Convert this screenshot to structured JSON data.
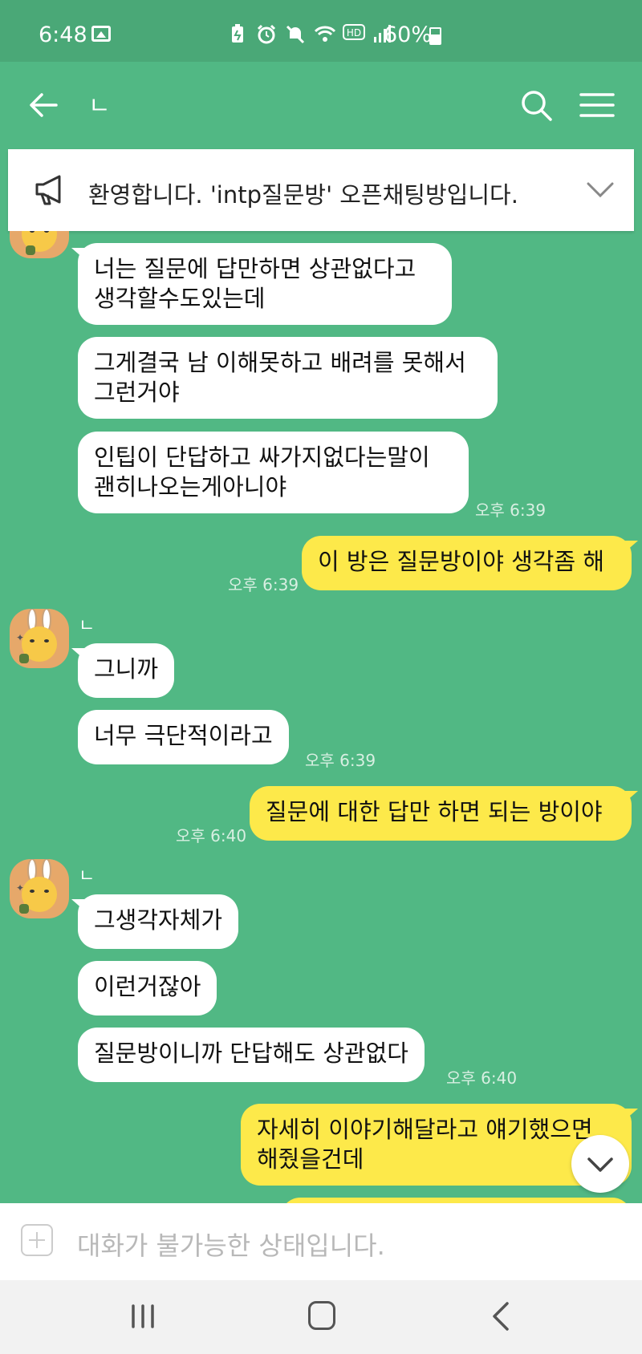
{
  "status_bar": {
    "time": "6:48",
    "battery": "60%"
  },
  "header": {
    "title": "ㄴ"
  },
  "notice": {
    "text": "환영합니다. 'intp질문방' 오픈채팅방입니다."
  },
  "messages": {
    "g1": {
      "b1": "너는 질문에 답만하면 상관없다고\n생각할수도있는데",
      "b2": "그게결국 남 이해못하고 배려를 못해서\n그런거야",
      "b3": "인팁이 단답하고 싸가지없다는말이\n괜히나오는게아니야",
      "time": "오후 6:39"
    },
    "o1": {
      "text": "이 방은 질문방이야 생각좀 해",
      "time": "오후 6:39"
    },
    "g2": {
      "sender": "ㄴ",
      "b1": "그니까",
      "b2": "너무 극단적이라고",
      "time": "오후 6:39"
    },
    "o2": {
      "text": "질문에 대한 답만 하면 되는 방이야",
      "time": "오후 6:40"
    },
    "g3": {
      "sender": "ㄴ",
      "b1": "그생각자체가",
      "b2": "이런거잖아",
      "b3": "질문방이니까 단답해도 상관없다",
      "time": "오후 6:40"
    },
    "o3": {
      "text": "자세히 이야기해달라고 얘기했으면\n해줬을건데"
    }
  },
  "input": {
    "placeholder": "대화가 불가능한 상태입니다."
  },
  "colors": {
    "chat_bg": "#51b884",
    "status_bg": "#4aa877",
    "outgoing": "#fde94a",
    "incoming": "#ffffff"
  }
}
